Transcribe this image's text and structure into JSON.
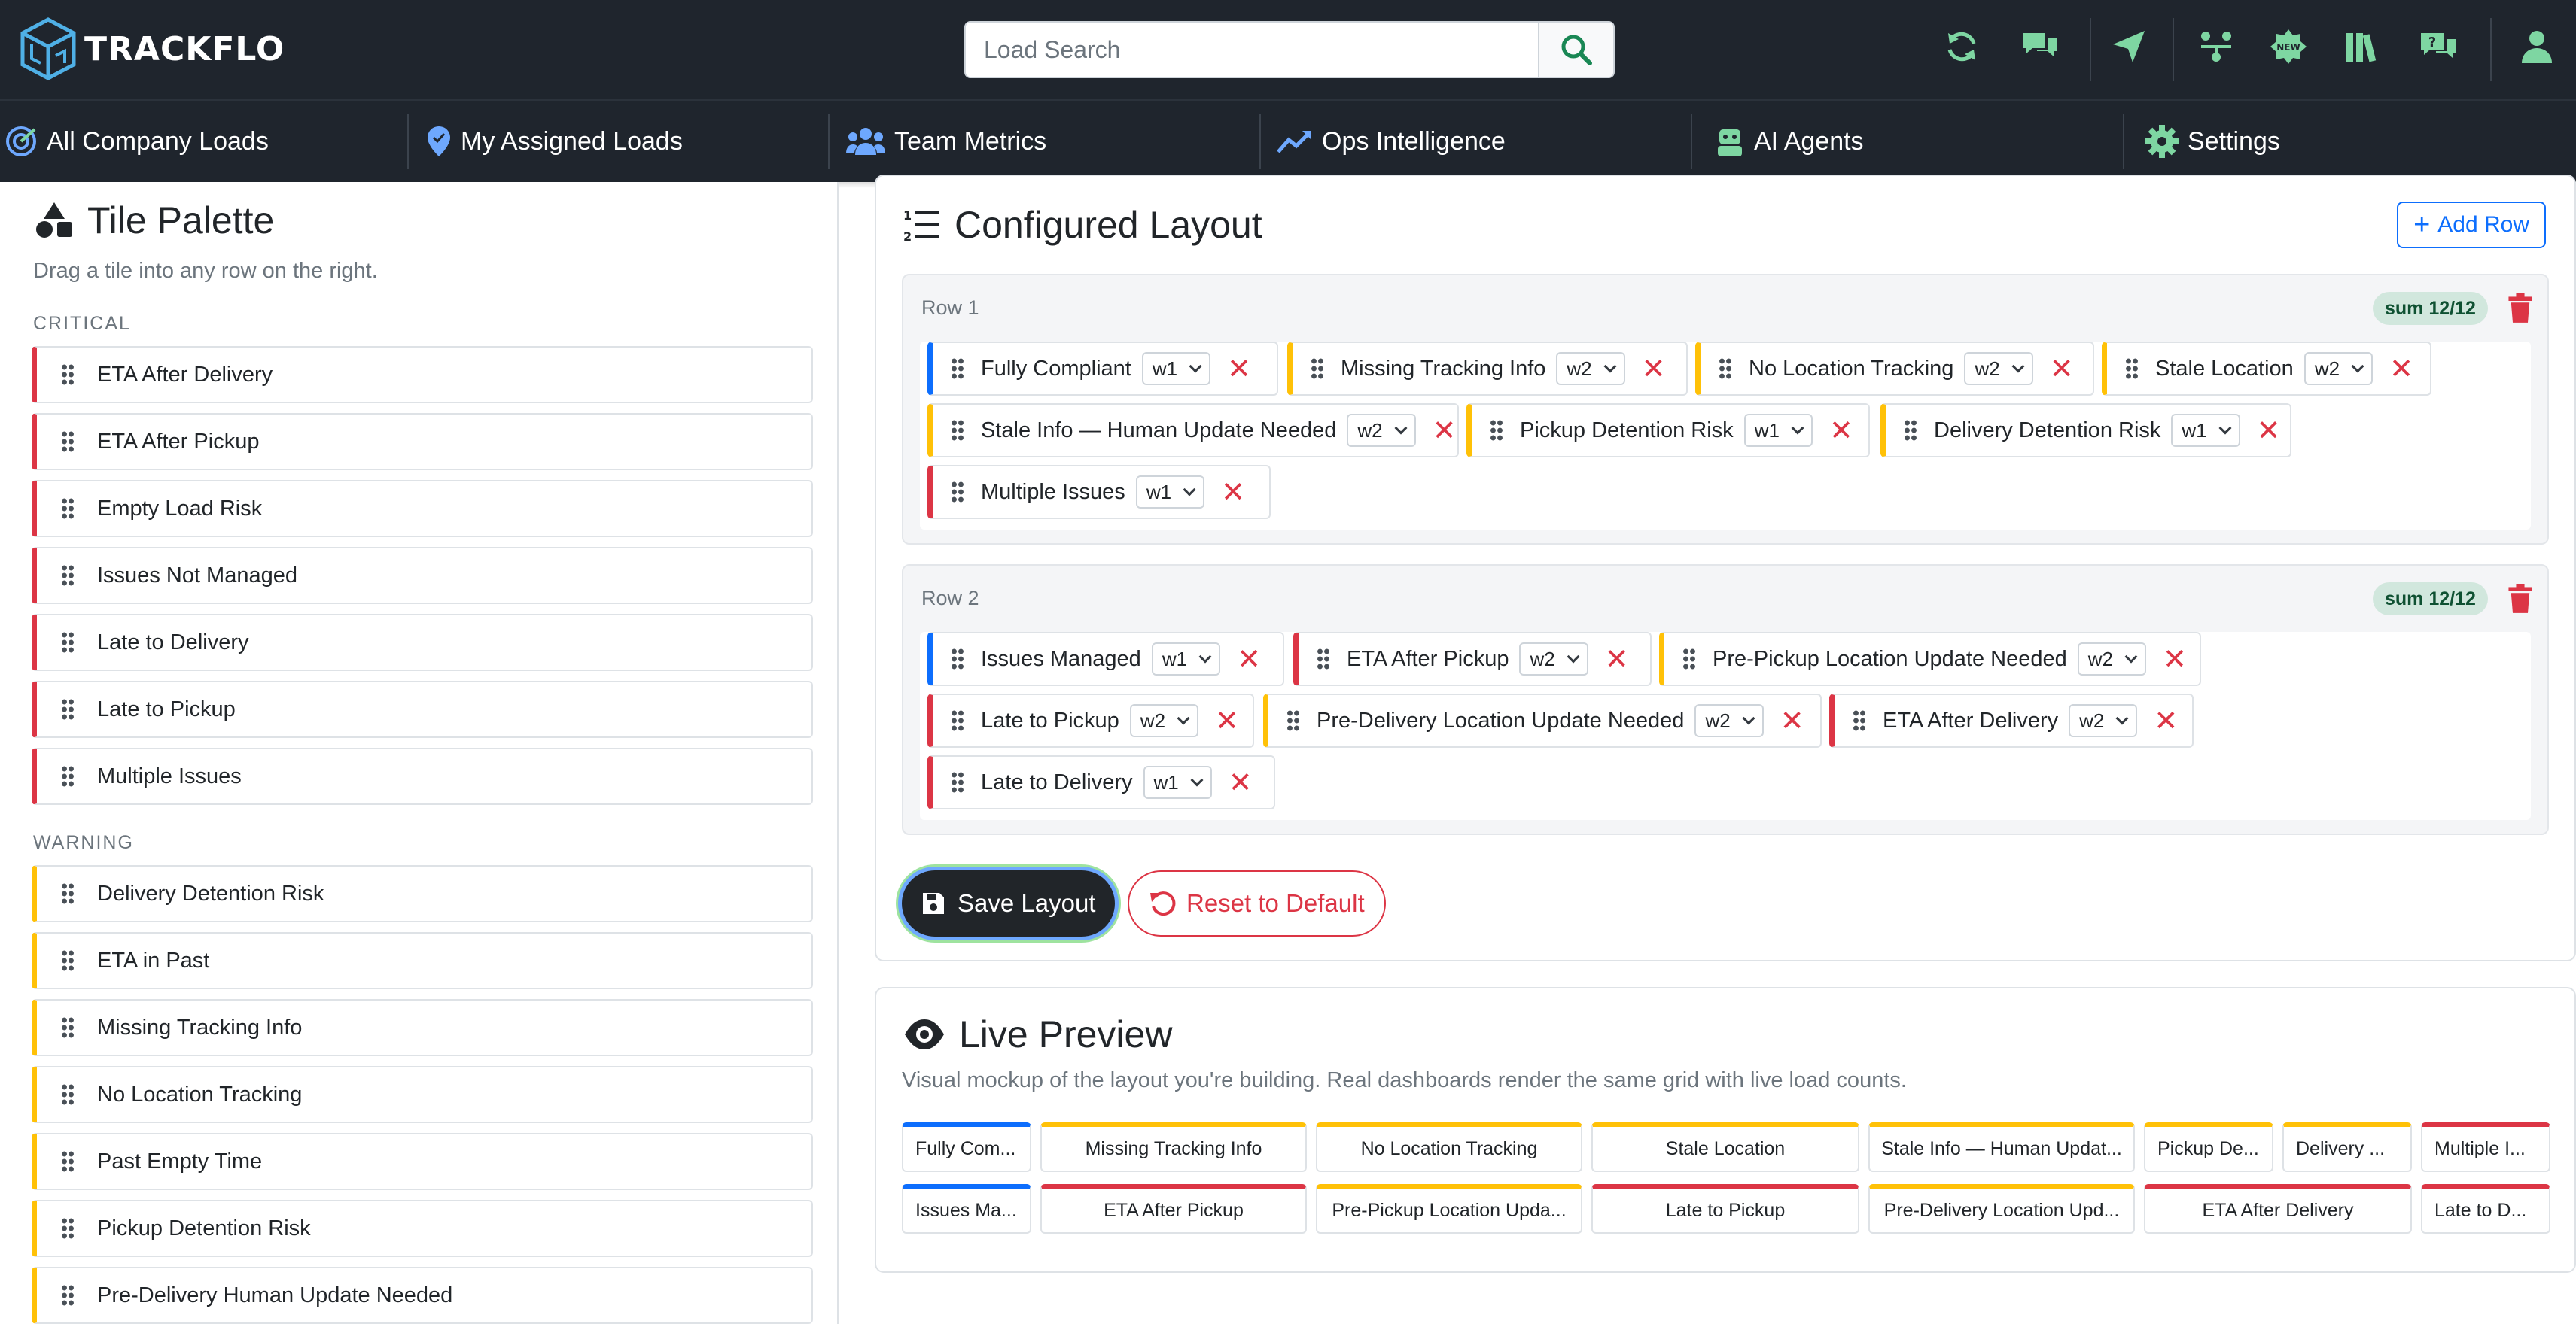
{
  "app": {
    "name": "TRACKFLO"
  },
  "search": {
    "placeholder": "Load Search"
  },
  "nav": {
    "items": [
      {
        "label": "All Company Loads",
        "icon": "radar-icon"
      },
      {
        "label": "My Assigned Loads",
        "icon": "map-pin-icon"
      },
      {
        "label": "Team Metrics",
        "icon": "team-icon"
      },
      {
        "label": "Ops Intelligence",
        "icon": "trend-icon"
      },
      {
        "label": "AI Agents",
        "icon": "robot-icon"
      },
      {
        "label": "Settings",
        "icon": "gear-icon"
      }
    ]
  },
  "palette": {
    "title": "Tile Palette",
    "subtitle": "Drag a tile into any row on the right.",
    "critical_label": "CRITICAL",
    "critical": [
      "ETA After Delivery",
      "ETA After Pickup",
      "Empty Load Risk",
      "Issues Not Managed",
      "Late to Delivery",
      "Late to Pickup",
      "Multiple Issues"
    ],
    "warning_label": "WARNING",
    "warning": [
      "Delivery Detention Risk",
      "ETA in Past",
      "Missing Tracking Info",
      "No Location Tracking",
      "Past Empty Time",
      "Pickup Detention Risk",
      "Pre-Delivery Human Update Needed"
    ]
  },
  "layout": {
    "title": "Configured Layout",
    "add_row": "Add Row",
    "rows": [
      {
        "label": "Row 1",
        "sum": "sum 12/12",
        "tiles": [
          {
            "name": "Fully Compliant",
            "width": "w1",
            "color": "blue"
          },
          {
            "name": "Missing Tracking Info",
            "width": "w2",
            "color": "yellow"
          },
          {
            "name": "No Location Tracking",
            "width": "w2",
            "color": "yellow"
          },
          {
            "name": "Stale Location",
            "width": "w2",
            "color": "yellow"
          },
          {
            "name": "Stale Info — Human Update Needed",
            "width": "w2",
            "color": "yellow"
          },
          {
            "name": "Pickup Detention Risk",
            "width": "w1",
            "color": "yellow"
          },
          {
            "name": "Delivery Detention Risk",
            "width": "w1",
            "color": "yellow"
          },
          {
            "name": "Multiple Issues",
            "width": "w1",
            "color": "red"
          }
        ]
      },
      {
        "label": "Row 2",
        "sum": "sum 12/12",
        "tiles": [
          {
            "name": "Issues Managed",
            "width": "w1",
            "color": "blue"
          },
          {
            "name": "ETA After Pickup",
            "width": "w2",
            "color": "red"
          },
          {
            "name": "Pre-Pickup Location Update Needed",
            "width": "w2",
            "color": "yellow"
          },
          {
            "name": "Late to Pickup",
            "width": "w2",
            "color": "red"
          },
          {
            "name": "Pre-Delivery Location Update Needed",
            "width": "w2",
            "color": "yellow"
          },
          {
            "name": "ETA After Delivery",
            "width": "w2",
            "color": "red"
          },
          {
            "name": "Late to Delivery",
            "width": "w1",
            "color": "red"
          }
        ]
      }
    ],
    "save": "Save Layout",
    "reset": "Reset to Default"
  },
  "preview": {
    "title": "Live Preview",
    "subtitle": "Visual mockup of the layout you're building. Real dashboards render the same grid with live load counts.",
    "row1": [
      "Fully Com...",
      "Missing Tracking Info",
      "No Location Tracking",
      "Stale Location",
      "Stale Info — Human Updat...",
      "Pickup De...",
      "Delivery ...",
      "Multiple I..."
    ],
    "row2": [
      "Issues Ma...",
      "ETA After Pickup",
      "Pre-Pickup Location Upda...",
      "Late to Pickup",
      "Pre-Delivery Location Upd...",
      "ETA After Delivery",
      "Late to D..."
    ]
  },
  "colors": {
    "blue": "#0d6efd",
    "red": "#dc3545",
    "yellow": "#ffc107",
    "icon_green": "#7ed6a2"
  }
}
